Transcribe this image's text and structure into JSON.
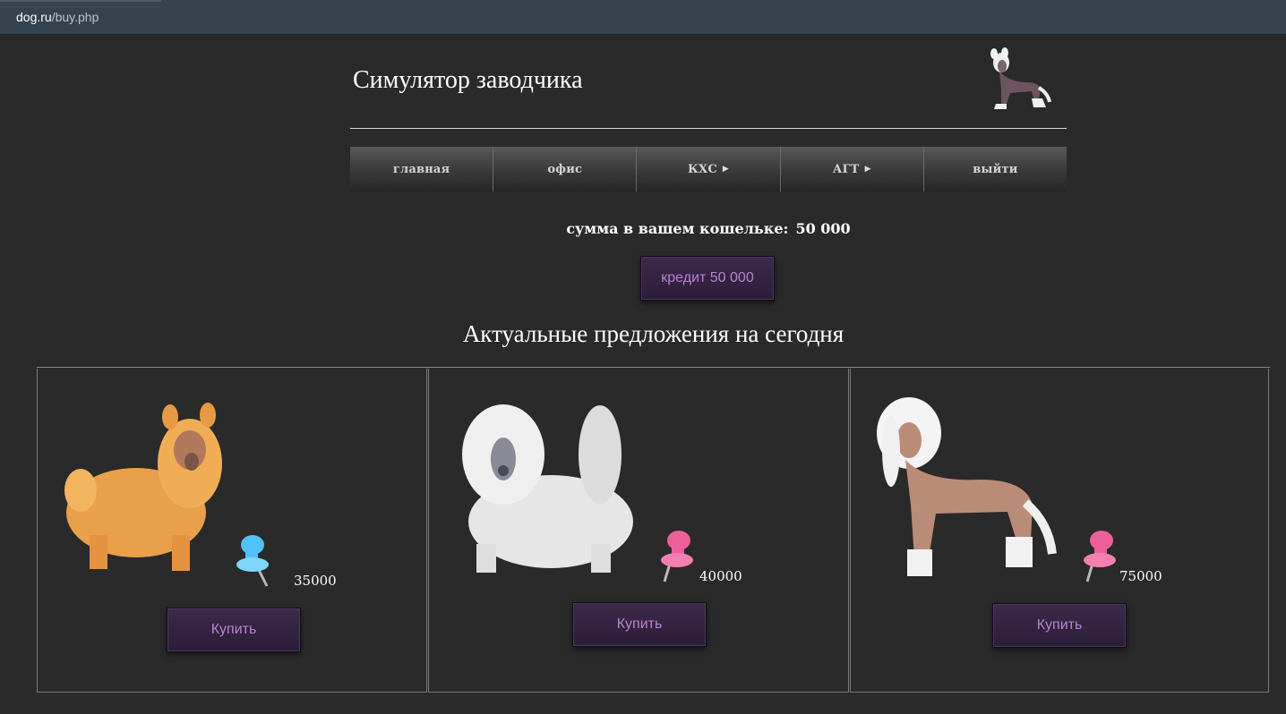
{
  "browser": {
    "url_host": "dog.ru",
    "url_path": "/buy.php"
  },
  "header": {
    "title": "Симулятор заводчика",
    "logo_icon": "dog-logo-icon"
  },
  "nav": {
    "items": [
      {
        "label": "главная"
      },
      {
        "label": "офис"
      },
      {
        "label": "КХС",
        "arrow": "▶"
      },
      {
        "label": "АГТ",
        "arrow": "▶"
      },
      {
        "label": "выйти"
      }
    ]
  },
  "wallet": {
    "label": "сумма в вашем кошельке:",
    "amount": "50 000"
  },
  "credit_button": {
    "label": "кредит 50 000"
  },
  "offers": {
    "title": "Актуальные предложения на сегодня",
    "items": [
      {
        "price": "35000",
        "buy_label": "Купить",
        "pin_color": "#4fc3f7",
        "dog_color": "#e9a04a"
      },
      {
        "price": "40000",
        "buy_label": "Купить",
        "pin_color": "#ec5f9b",
        "dog_color": "#e6e6e6"
      },
      {
        "price": "75000",
        "buy_label": "Купить",
        "pin_color": "#ec5f9b",
        "dog_color": "#b98c78"
      }
    ]
  },
  "colors": {
    "background": "#2a2a2a",
    "button_text": "#b784d0",
    "button_bg": "#2f2040"
  }
}
